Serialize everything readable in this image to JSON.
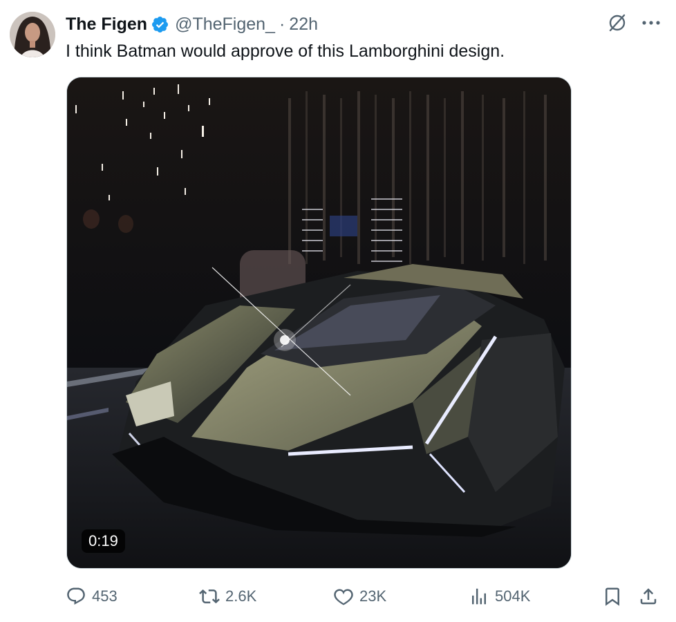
{
  "author": {
    "display_name": "The Figen",
    "handle": "@TheFigen_",
    "separator": "·",
    "time": "22h",
    "verified": true
  },
  "tweet": {
    "text": "I think Batman would approve of this Lamborghini design."
  },
  "media": {
    "type": "video",
    "duration": "0:19"
  },
  "actions": {
    "replies": "453",
    "reposts": "2.6K",
    "likes": "23K",
    "views": "504K"
  },
  "icons": {
    "top": [
      "grok-icon",
      "more-icon"
    ],
    "bottom": [
      "reply-icon",
      "repost-icon",
      "like-icon",
      "views-icon",
      "bookmark-icon",
      "share-icon"
    ]
  },
  "colors": {
    "text_primary": "#0f1419",
    "text_secondary": "#536471",
    "verified": "#1d9bf0",
    "border": "#cfd9de"
  }
}
